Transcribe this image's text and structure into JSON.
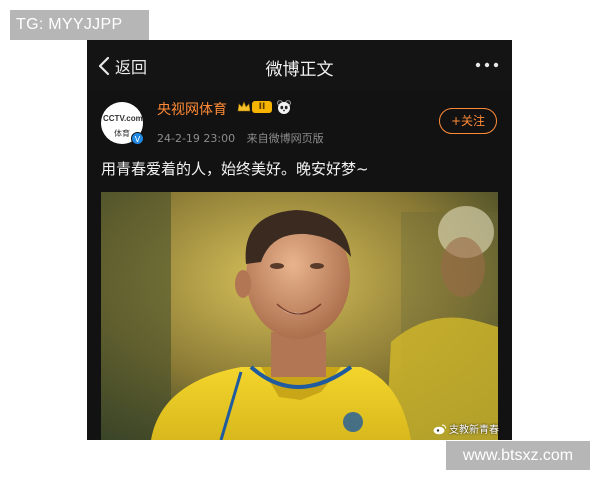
{
  "overlay": {
    "tg_label": "TG: MYYJJPP",
    "site_label": "www.btsxz.com",
    "watermark": "支教新青春"
  },
  "topbar": {
    "back_label": "返回",
    "title": "微博正文"
  },
  "post": {
    "author": "央视网体育",
    "level_badge": "II",
    "timestamp": "24-2-19 23:00",
    "source": "来自微博网页版",
    "follow_label": "+关注",
    "text": "用青春爱着的人，始终美好。晚安好梦~",
    "avatar_text_top": "CCTV.com",
    "avatar_text_bottom": "体育",
    "verified_mark": "V"
  },
  "icons": [
    "back-chevron-icon",
    "more-icon",
    "crown-badge-icon",
    "panda-badge-icon",
    "verified-icon",
    "weibo-icon"
  ],
  "colors": {
    "accent": "#ff8a35",
    "background": "#121212",
    "jersey": "#f2d22a",
    "overlay_gray": "#b6b6b6"
  }
}
